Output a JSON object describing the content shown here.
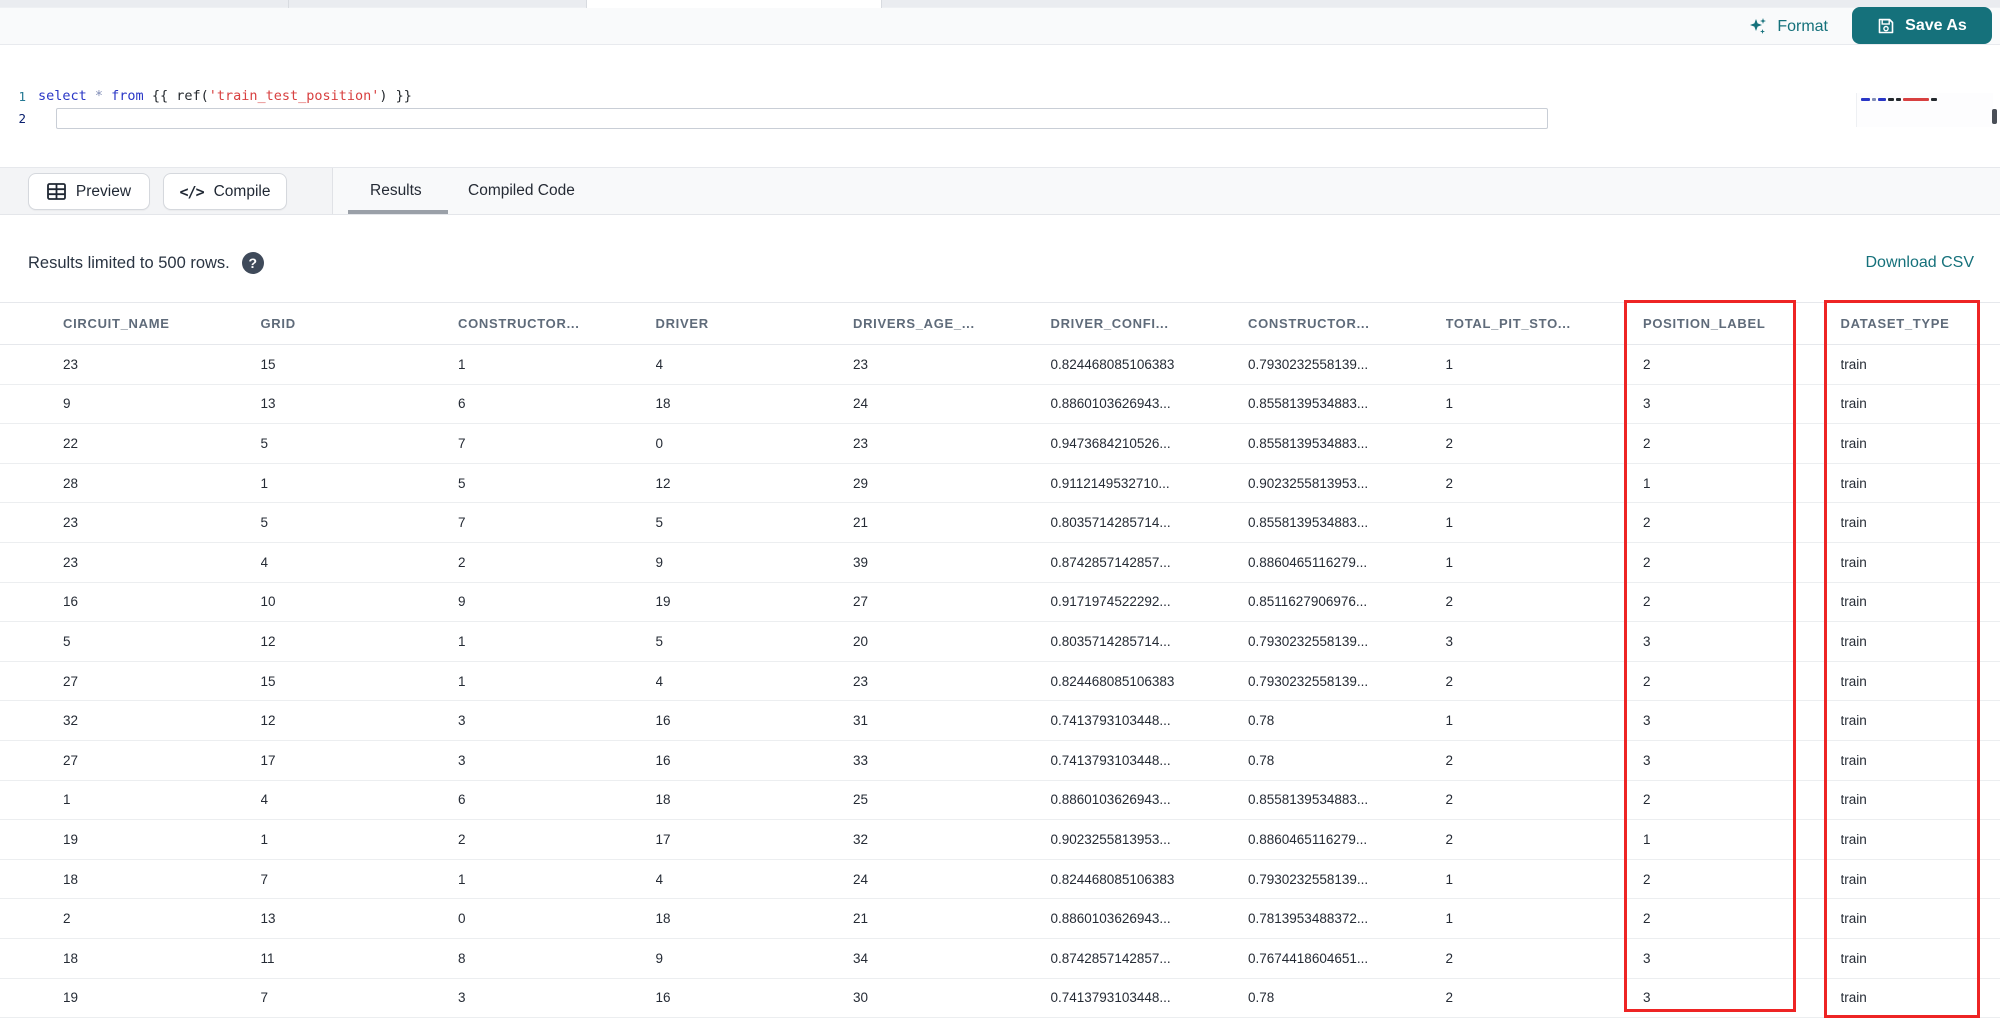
{
  "accent_color": "#15717b",
  "annotation_color": "#ee2424",
  "top_bar": {
    "format_label": "Format",
    "save_as_label": "Save As"
  },
  "editor": {
    "line_numbers": {
      "line1": "1",
      "line2": "2"
    },
    "code_tokens": [
      {
        "t": "select ",
        "c": "kw"
      },
      {
        "t": "* ",
        "c": "op"
      },
      {
        "t": "from ",
        "c": "kw"
      },
      {
        "t": "{{ ",
        "c": "pln"
      },
      {
        "t": "ref(",
        "c": "pln"
      },
      {
        "t": "'train_test_position'",
        "c": "str"
      },
      {
        "t": ") ",
        "c": "pln"
      },
      {
        "t": "}}",
        "c": "pln"
      }
    ]
  },
  "toolbar": {
    "preview_label": "Preview",
    "compile_label": "Compile",
    "compile_glyph": "</>",
    "tabs": {
      "results": "Results",
      "compiled_code": "Compiled Code"
    },
    "active_tab": "Results"
  },
  "results_bar": {
    "info_text": "Results limited to 500 rows.",
    "help_glyph": "?",
    "download_label": "Download CSV"
  },
  "table": {
    "headers": [
      "CIRCUIT_NAME",
      "GRID",
      "CONSTRUCTOR...",
      "DRIVER",
      "DRIVERS_AGE_...",
      "DRIVER_CONFI...",
      "CONSTRUCTOR...",
      "TOTAL_PIT_STO...",
      "POSITION_LABEL",
      "DATASET_TYPE"
    ],
    "rows": [
      [
        "23",
        "15",
        "1",
        "4",
        "23",
        "0.824468085106383",
        "0.7930232558139...",
        "1",
        "2",
        "train"
      ],
      [
        "9",
        "13",
        "6",
        "18",
        "24",
        "0.8860103626943...",
        "0.8558139534883...",
        "1",
        "3",
        "train"
      ],
      [
        "22",
        "5",
        "7",
        "0",
        "23",
        "0.9473684210526...",
        "0.8558139534883...",
        "2",
        "2",
        "train"
      ],
      [
        "28",
        "1",
        "5",
        "12",
        "29",
        "0.9112149532710...",
        "0.9023255813953...",
        "2",
        "1",
        "train"
      ],
      [
        "23",
        "5",
        "7",
        "5",
        "21",
        "0.8035714285714...",
        "0.8558139534883...",
        "1",
        "2",
        "train"
      ],
      [
        "23",
        "4",
        "2",
        "9",
        "39",
        "0.8742857142857...",
        "0.8860465116279...",
        "1",
        "2",
        "train"
      ],
      [
        "16",
        "10",
        "9",
        "19",
        "27",
        "0.9171974522292...",
        "0.8511627906976...",
        "2",
        "2",
        "train"
      ],
      [
        "5",
        "12",
        "1",
        "5",
        "20",
        "0.8035714285714...",
        "0.7930232558139...",
        "3",
        "3",
        "train"
      ],
      [
        "27",
        "15",
        "1",
        "4",
        "23",
        "0.824468085106383",
        "0.7930232558139...",
        "2",
        "2",
        "train"
      ],
      [
        "32",
        "12",
        "3",
        "16",
        "31",
        "0.7413793103448...",
        "0.78",
        "1",
        "3",
        "train"
      ],
      [
        "27",
        "17",
        "3",
        "16",
        "33",
        "0.7413793103448...",
        "0.78",
        "2",
        "3",
        "train"
      ],
      [
        "1",
        "4",
        "6",
        "18",
        "25",
        "0.8860103626943...",
        "0.8558139534883...",
        "2",
        "2",
        "train"
      ],
      [
        "19",
        "1",
        "2",
        "17",
        "32",
        "0.9023255813953...",
        "0.8860465116279...",
        "2",
        "1",
        "train"
      ],
      [
        "18",
        "7",
        "1",
        "4",
        "24",
        "0.824468085106383",
        "0.7930232558139...",
        "1",
        "2",
        "train"
      ],
      [
        "2",
        "13",
        "0",
        "18",
        "21",
        "0.8860103626943...",
        "0.7813953488372...",
        "1",
        "2",
        "train"
      ],
      [
        "18",
        "11",
        "8",
        "9",
        "34",
        "0.8742857142857...",
        "0.7674418604651...",
        "2",
        "3",
        "train"
      ],
      [
        "19",
        "7",
        "3",
        "16",
        "30",
        "0.7413793103448...",
        "0.78",
        "2",
        "3",
        "train"
      ]
    ],
    "highlighted_columns": [
      "POSITION_LABEL",
      "DATASET_TYPE"
    ]
  }
}
